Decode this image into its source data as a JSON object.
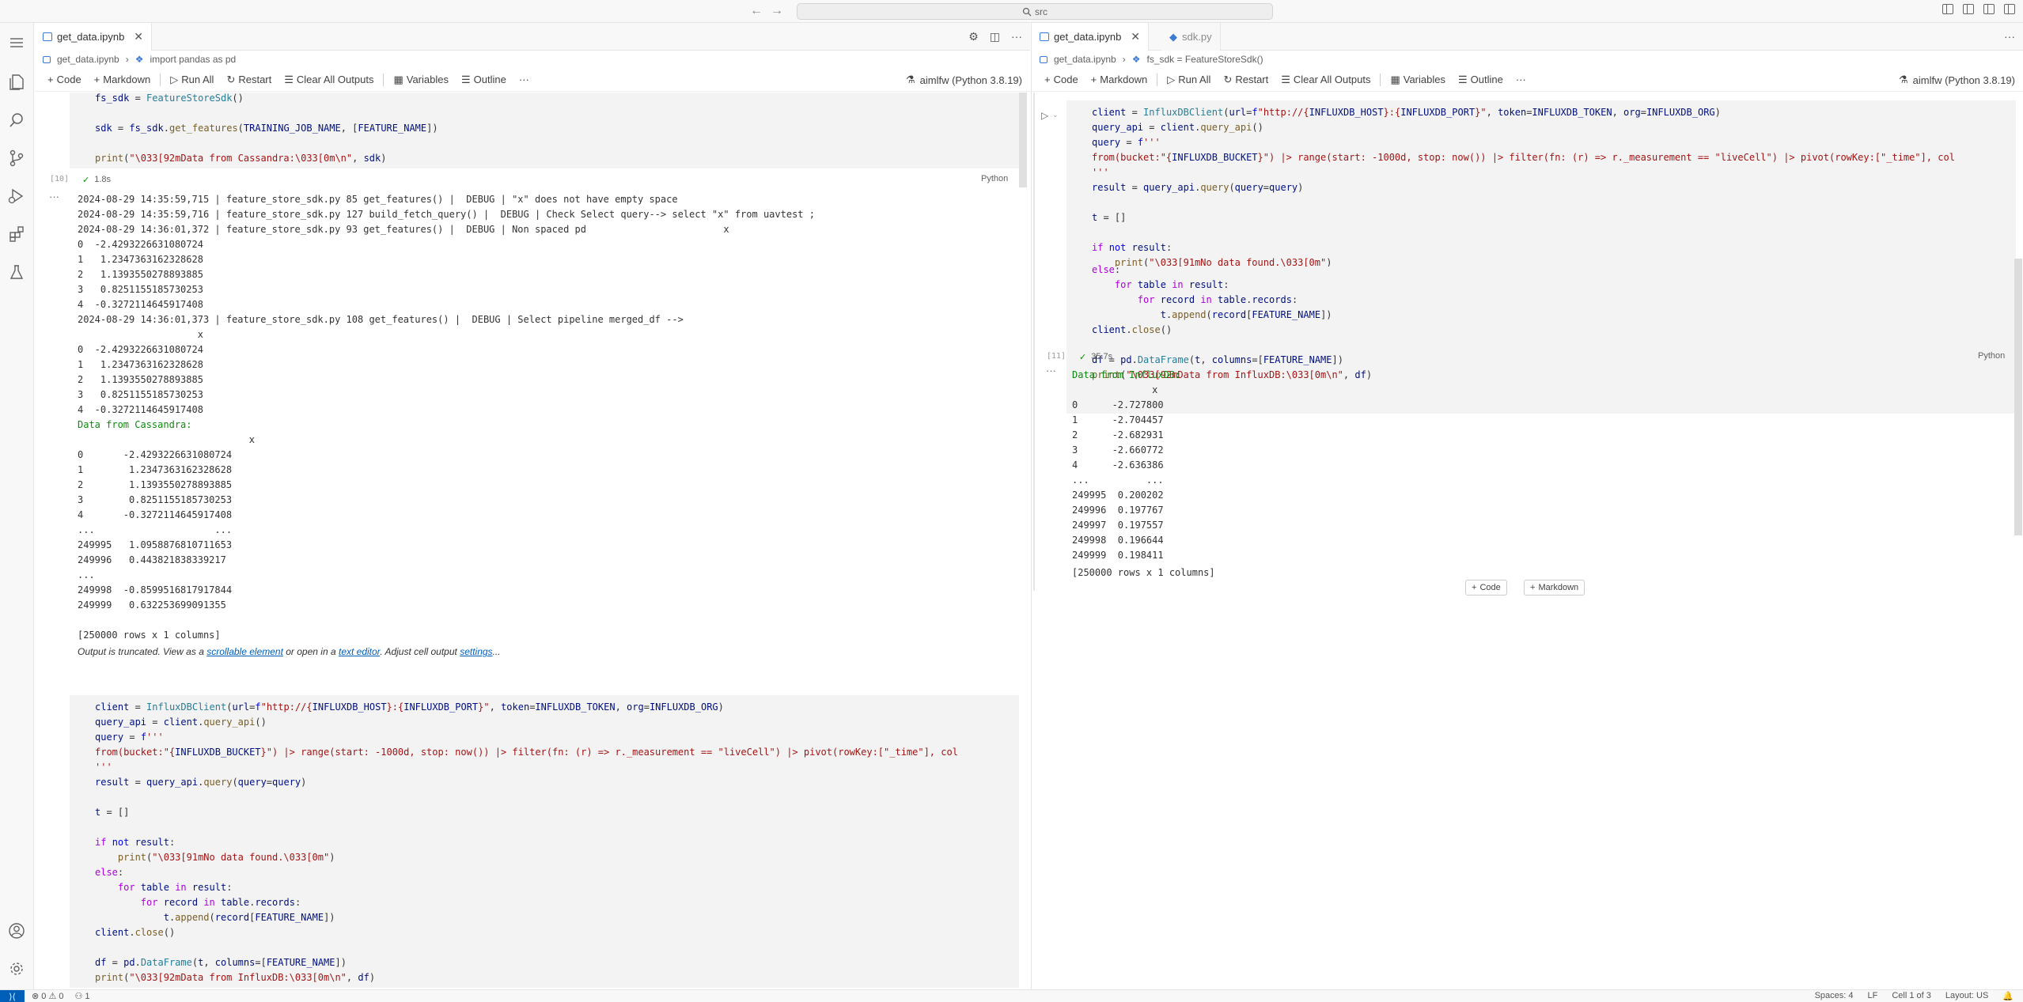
{
  "window": {
    "search_text": "src",
    "nav_back": "←",
    "nav_forward": "→"
  },
  "status_bar": {
    "remote": "⟩⟨",
    "problems": "⊗ 0 ⚠ 0",
    "ports": "⚇ 1",
    "spaces": "Spaces: 4",
    "eol": "LF",
    "cell": "Cell 1 of 3",
    "layout": "Layout: US",
    "bell": "🔔"
  },
  "left_pane": {
    "tab_label": "get_data.ipynb",
    "breadcrumb": [
      "get_data.ipynb",
      "import pandas as pd"
    ],
    "toolbar": {
      "code": "Code",
      "markdown": "Markdown",
      "run_all": "Run All",
      "restart": "Restart",
      "clear_outputs": "Clear All Outputs",
      "variables": "Variables",
      "outline": "Outline",
      "more": "···",
      "kernel": "aimlfw (Python 3.8.19)"
    },
    "cell1": {
      "exec_count": "[10]",
      "duration": "1.8s",
      "language": "Python"
    },
    "output1": [
      "2024-08-29 14:35:59,715 | feature_store_sdk.py 85 get_features() |  DEBUG | \"x\" does not have empty space",
      "2024-08-29 14:35:59,716 | feature_store_sdk.py 127 build_fetch_query() |  DEBUG | Check Select query--> select \"x\" from uavtest ;",
      "2024-08-29 14:36:01,372 | feature_store_sdk.py 93 get_features() |  DEBUG | Non spaced pd                        x",
      "0  -2.4293226631080724",
      "1   1.2347363162328628",
      "2   1.1393550278893885",
      "3   0.8251155185730253",
      "4  -0.3272114645917408",
      "2024-08-29 14:36:01,373 | feature_store_sdk.py 108 get_features() |  DEBUG | Select pipeline merged_df -->",
      "                     x",
      "0  -2.4293226631080724",
      "1   1.2347363162328628",
      "2   1.1393550278893885",
      "3   0.8251155185730253",
      "4  -0.3272114645917408",
      "Data from Cassandra:",
      "                              x",
      "0       -2.4293226631080724",
      "1        1.2347363162328628",
      "2        1.1393550278893885",
      "3        0.8251155185730253",
      "4       -0.3272114645917408",
      "...                     ...",
      "249995   1.0958876810711653",
      "249996   0.443821838339217",
      "...",
      "249998  -0.8599516817917844",
      "249999   0.632253699091355"
    ],
    "rows_summary": "[250000 rows x 1 columns]",
    "trunc": {
      "prefix": "Output is truncated. View as a ",
      "link1": "scrollable element",
      "mid": " or open in a ",
      "link2": "text editor",
      "mid2": ". Adjust cell output ",
      "link3": "settings",
      "suffix": "..."
    }
  },
  "right_pane": {
    "tab_active": "get_data.ipynb",
    "tab_inactive": "sdk.py",
    "breadcrumb": [
      "get_data.ipynb",
      "fs_sdk = FeatureStoreSdk()"
    ],
    "toolbar": {
      "code": "Code",
      "markdown": "Markdown",
      "run_all": "Run All",
      "restart": "Restart",
      "clear_outputs": "Clear All Outputs",
      "variables": "Variables",
      "outline": "Outline",
      "more": "···",
      "kernel": "aimlfw (Python 3.8.19)"
    },
    "cell": {
      "exec_count": "[11]",
      "duration": "35.7s",
      "language": "Python"
    },
    "output": [
      "Data from InfluxDB:",
      "              x",
      "0      -2.727800",
      "1      -2.704457",
      "2      -2.682931",
      "3      -2.660772",
      "4      -2.636386",
      "...          ...",
      "249995  0.200202",
      "249996  0.197767",
      "249997  0.197557",
      "249998  0.196644",
      "249999  0.198411"
    ],
    "rows_summary": "[250000 rows x 1 columns]",
    "add_code": "Code",
    "add_markdown": "Markdown"
  }
}
